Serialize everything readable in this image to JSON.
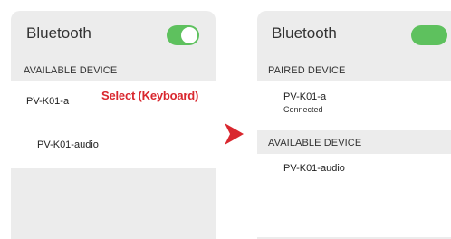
{
  "left_screen": {
    "title": "Bluetooth",
    "toggle_on": true,
    "available_header": "AVAILABLE DEVICE",
    "devices": [
      {
        "name": "PV-K01-a"
      },
      {
        "name": "PV-K01-audio"
      }
    ],
    "annotation": "Select (Keyboard)"
  },
  "right_screen": {
    "title": "Bluetooth",
    "toggle_on": true,
    "paired_header": "PAIRED DEVICE",
    "paired_devices": [
      {
        "name": "PV-K01-a",
        "status": "Connected"
      }
    ],
    "available_header": "AVAILABLE DEVICE",
    "available_devices": [
      {
        "name": "PV-K01-audio"
      }
    ]
  },
  "colors": {
    "accent_green": "#5ec15e",
    "annotation_red": "#d9272e",
    "panel_bg": "#ececec"
  },
  "icons": {
    "arrow": "chevron-right-icon"
  }
}
